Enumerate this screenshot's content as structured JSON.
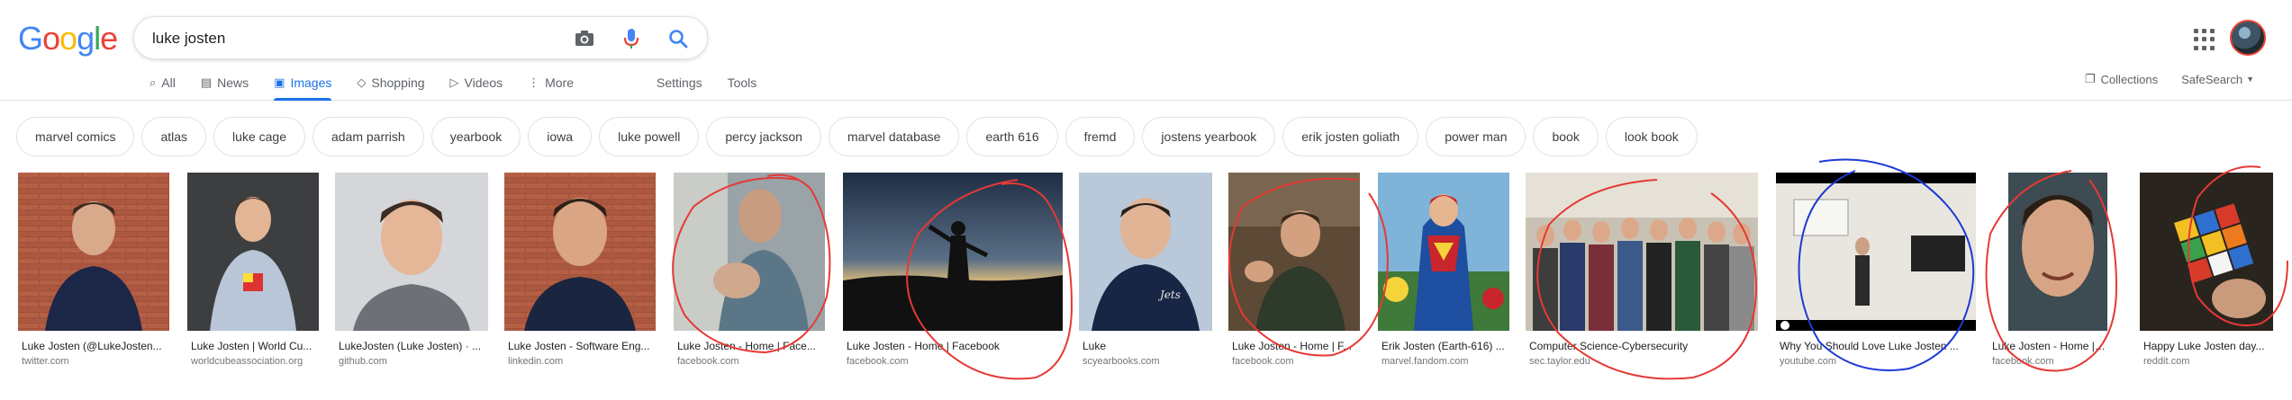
{
  "logo": {
    "text": "Google",
    "letters": [
      {
        "ch": "G",
        "color": "#4285f4"
      },
      {
        "ch": "o",
        "color": "#ea4335"
      },
      {
        "ch": "o",
        "color": "#fbbc05"
      },
      {
        "ch": "g",
        "color": "#4285f4"
      },
      {
        "ch": "l",
        "color": "#34a853"
      },
      {
        "ch": "e",
        "color": "#ea4335"
      }
    ]
  },
  "search": {
    "query": "luke josten"
  },
  "tabs": [
    {
      "label": "All",
      "icon": "search-icon"
    },
    {
      "label": "News",
      "icon": "news-icon"
    },
    {
      "label": "Images",
      "icon": "image-icon",
      "active": true
    },
    {
      "label": "Shopping",
      "icon": "tag-icon"
    },
    {
      "label": "Videos",
      "icon": "play-icon"
    },
    {
      "label": "More",
      "icon": "more-vert-icon"
    }
  ],
  "tools": {
    "settings": "Settings",
    "tools": "Tools"
  },
  "right": {
    "collections": "Collections",
    "safesearch": "SafeSearch"
  },
  "chips": [
    "marvel comics",
    "atlas",
    "luke cage",
    "adam parrish",
    "yearbook",
    "iowa",
    "luke powell",
    "percy jackson",
    "marvel database",
    "earth 616",
    "fremd",
    "jostens yearbook",
    "erik josten goliath",
    "power man",
    "book",
    "look book"
  ],
  "results": [
    {
      "caption": "Luke Josten (@LukeJosten...",
      "source": "twitter.com"
    },
    {
      "caption": "Luke Josten | World Cu...",
      "source": "worldcubeassociation.org"
    },
    {
      "caption": "LukeJosten (Luke Josten) · ...",
      "source": "github.com"
    },
    {
      "caption": "Luke Josten - Software Eng...",
      "source": "linkedin.com"
    },
    {
      "caption": "Luke Josten - Home | Face...",
      "source": "facebook.com"
    },
    {
      "caption": "Luke Josten - Home | Facebook",
      "source": "facebook.com"
    },
    {
      "caption": "Luke",
      "source": "scyearbooks.com"
    },
    {
      "caption": "Luke Josten - Home | F...",
      "source": "facebook.com"
    },
    {
      "caption": "Erik Josten (Earth-616) ...",
      "source": "marvel.fandom.com"
    },
    {
      "caption": "Computer Science-Cybersecurity",
      "source": "sec.taylor.edu"
    },
    {
      "caption": "Why You Should Love Luke Josten ...",
      "source": "youtube.com"
    },
    {
      "caption": "Luke Josten - Home | F...",
      "source": "facebook.com"
    },
    {
      "caption": "Happy Luke Josten day...",
      "source": "reddit.com"
    }
  ],
  "colors": {
    "accent": "#1a73e8",
    "annotation_red": "#e53935",
    "annotation_blue": "#1e3ad6"
  }
}
